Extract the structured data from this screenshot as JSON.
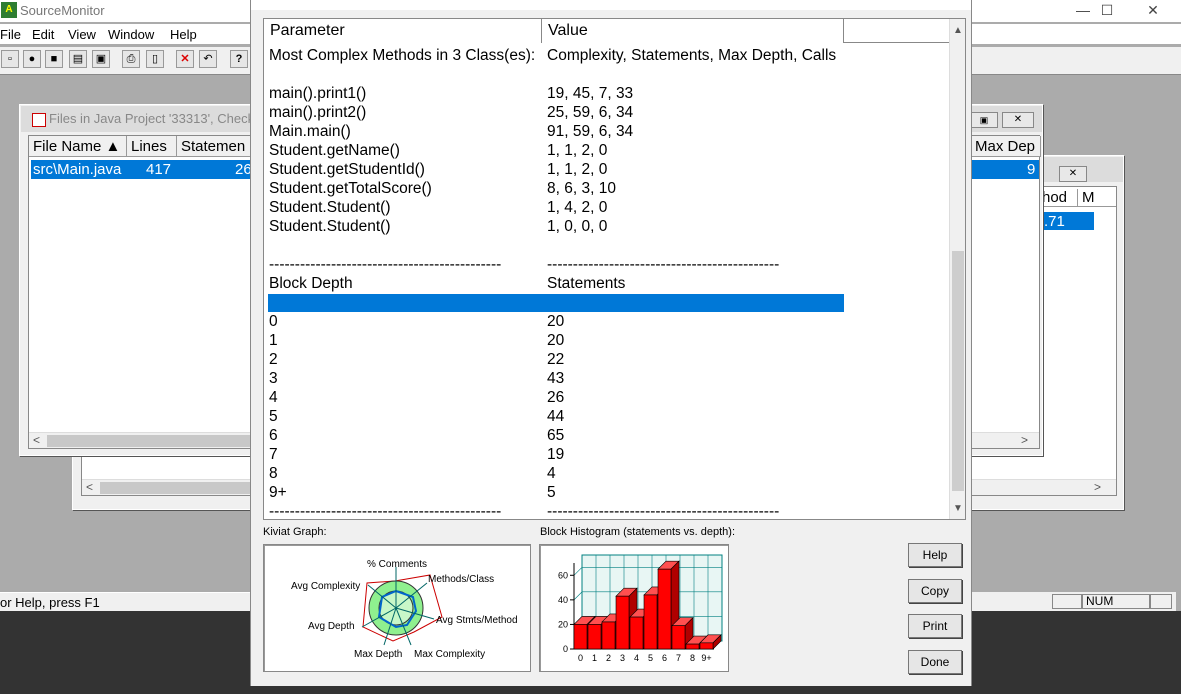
{
  "app": {
    "title": "SourceMonitor"
  },
  "window_controls": {
    "minimize": "—",
    "maximize": "☐",
    "close": "✕"
  },
  "menu": [
    "File",
    "Edit",
    "View",
    "Window",
    "Help"
  ],
  "files_window": {
    "title": "Files in Java Project '33313', Check",
    "columns": [
      "File Name ▲",
      "Lines",
      "Statemen"
    ],
    "right_column": "Max Dep",
    "row": {
      "file": "src\\Main.java",
      "lines": "417",
      "statements": "26",
      "max_depth": "9"
    }
  },
  "second_window": {
    "col_a": "hod",
    "col_b": "M",
    "value": ".71"
  },
  "status": {
    "help_text": "or Help, press F1",
    "num": "NUM"
  },
  "dialog": {
    "columns": {
      "parameter": "Parameter",
      "value": "Value"
    },
    "rows": [
      {
        "p": "Most Complex Methods in 3 Class(es):",
        "v": "Complexity, Statements, Max Depth, Calls"
      },
      {
        "p": "",
        "v": ""
      },
      {
        "p": "main().print1()",
        "v": "19, 45, 7, 33"
      },
      {
        "p": "main().print2()",
        "v": "25, 59, 6, 34"
      },
      {
        "p": "Main.main()",
        "v": "91, 59, 6, 34"
      },
      {
        "p": "Student.getName()",
        "v": "1, 1, 2, 0"
      },
      {
        "p": "Student.getStudentId()",
        "v": "1, 1, 2, 0"
      },
      {
        "p": "Student.getTotalScore()",
        "v": "8, 6, 3, 10"
      },
      {
        "p": "Student.Student()",
        "v": "1, 4, 2, 0"
      },
      {
        "p": "Student.Student()",
        "v": "1, 0, 0, 0"
      },
      {
        "p": "",
        "v": ""
      },
      {
        "p": "---------------------------------------------",
        "v": "---------------------------------------------"
      },
      {
        "p": "Block Depth",
        "v": "Statements"
      },
      {
        "p": "",
        "v": ""
      },
      {
        "p": "0",
        "v": "20"
      },
      {
        "p": "1",
        "v": "20"
      },
      {
        "p": "2",
        "v": "22"
      },
      {
        "p": "3",
        "v": "43"
      },
      {
        "p": "4",
        "v": "26"
      },
      {
        "p": "5",
        "v": "44"
      },
      {
        "p": "6",
        "v": "65"
      },
      {
        "p": "7",
        "v": "19"
      },
      {
        "p": "8",
        "v": "4"
      },
      {
        "p": "9+",
        "v": "5"
      },
      {
        "p": "---------------------------------------------",
        "v": "---------------------------------------------"
      }
    ],
    "kiviat": {
      "title": "Kiviat Graph:",
      "labels": [
        "% Comments",
        "Methods/Class",
        "Avg Stmts/Method",
        "Max Complexity",
        "Max Depth",
        "Avg Depth",
        "Avg Complexity"
      ]
    },
    "histogram": {
      "title": "Block Histogram (statements vs. depth):"
    },
    "buttons": {
      "help": "Help",
      "copy": "Copy",
      "print": "Print",
      "done": "Done"
    }
  },
  "chart_data": {
    "type": "bar",
    "title": "Block Histogram (statements vs. depth):",
    "categories": [
      "0",
      "1",
      "2",
      "3",
      "4",
      "5",
      "6",
      "7",
      "8",
      "9+"
    ],
    "values": [
      20,
      20,
      22,
      43,
      26,
      44,
      65,
      19,
      4,
      5
    ],
    "yticks": [
      0,
      20,
      40,
      60
    ],
    "ylim": [
      0,
      70
    ],
    "bar_color": "#ff0000",
    "grid_color": "#008080"
  },
  "colors": {
    "selection": "#0078d7",
    "bar": "#ff0000",
    "kiviat_fill": "#8ff08f"
  }
}
